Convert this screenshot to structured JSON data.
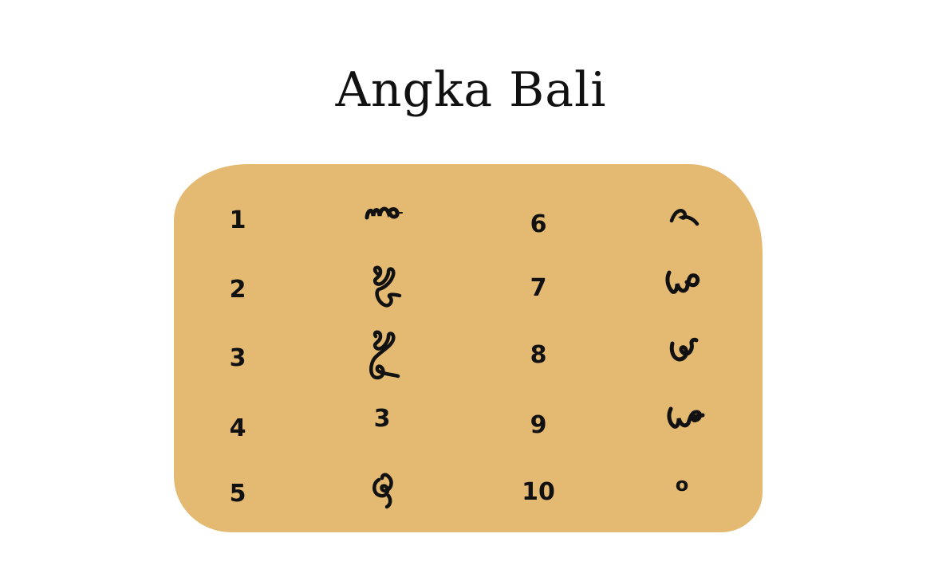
{
  "title": "Angka Bali",
  "card_color": "#E4BA73",
  "rows": [
    {
      "arabic": "1",
      "bali_icon": "balinese-digit-one-icon",
      "arabic2": "6",
      "bali2_icon": "balinese-digit-six-icon"
    },
    {
      "arabic": "2",
      "bali_icon": "balinese-digit-two-icon",
      "arabic2": "7",
      "bali2_icon": "balinese-digit-seven-icon"
    },
    {
      "arabic": "3",
      "bali_icon": "balinese-digit-three-icon",
      "arabic2": "8",
      "bali2_icon": "balinese-digit-eight-icon"
    },
    {
      "arabic": "4",
      "bali_text": "3",
      "arabic2": "9",
      "bali2_icon": "balinese-digit-nine-icon"
    },
    {
      "arabic": "5",
      "bali_icon": "balinese-digit-five-icon",
      "arabic2": "10",
      "bali2_text": "o"
    }
  ]
}
